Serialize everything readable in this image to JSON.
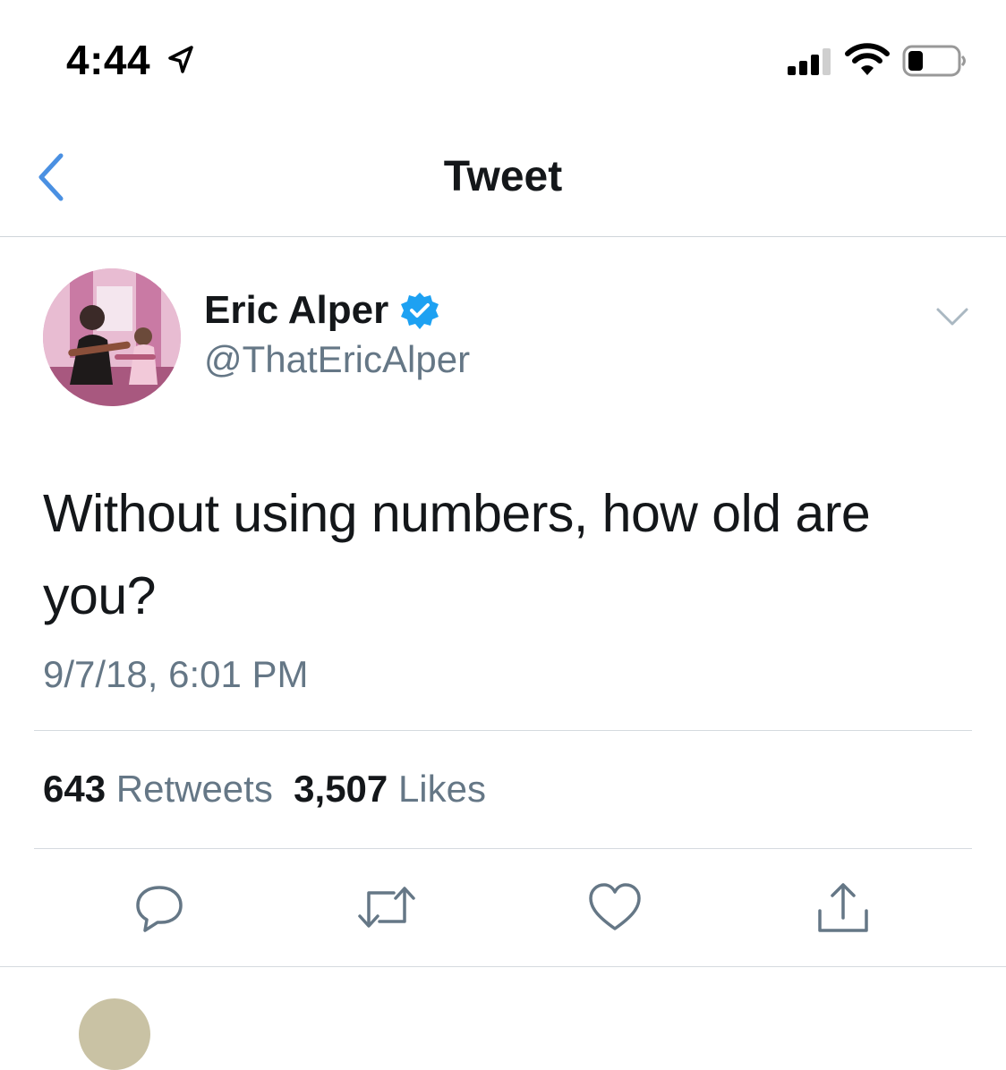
{
  "status_bar": {
    "time": "4:44",
    "icons": [
      "location-arrow-icon",
      "cellular-signal-icon",
      "wifi-icon",
      "battery-icon"
    ]
  },
  "nav": {
    "title": "Tweet",
    "back_icon": "chevron-left-icon",
    "accent_color": "#4a90e2"
  },
  "author": {
    "name": "Eric Alper",
    "handle": "@ThatEricAlper",
    "verified": true,
    "verified_color": "#1da1f2",
    "avatar_icon": "profile-photo"
  },
  "tweet": {
    "text": "Without using numbers, how old are you?",
    "timestamp": "9/7/18, 6:01 PM"
  },
  "stats": {
    "retweets_count": "643",
    "retweets_label": "Retweets",
    "likes_count": "3,507",
    "likes_label": "Likes"
  },
  "actions": [
    "reply-icon",
    "retweet-icon",
    "like-icon",
    "share-icon"
  ],
  "colors": {
    "text_primary": "#14171a",
    "text_secondary": "#657786",
    "divider": "#d5dadf"
  }
}
